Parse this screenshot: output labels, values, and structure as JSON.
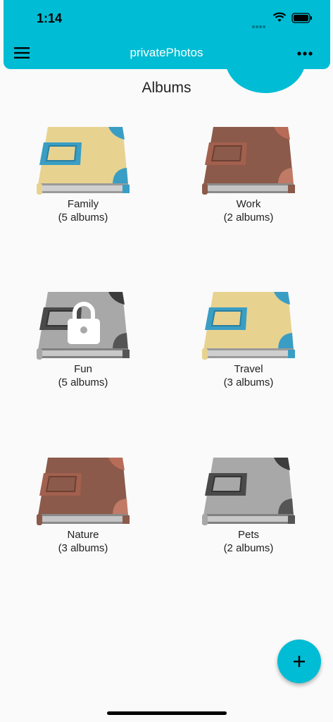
{
  "status_bar": {
    "time": "1:14"
  },
  "app_bar": {
    "title": "privatePhotos",
    "menu_icon": "hamburger-icon",
    "more_icon": "more-horizontal-icon"
  },
  "page": {
    "heading": "Albums"
  },
  "albums": [
    {
      "name": "Family",
      "count": "(5 albums)",
      "theme": "yellow-blue",
      "locked": false
    },
    {
      "name": "Work",
      "count": "(2 albums)",
      "theme": "brown",
      "locked": false
    },
    {
      "name": "Fun",
      "count": "(5 albums)",
      "theme": "grey",
      "locked": true
    },
    {
      "name": "Travel",
      "count": "(3 albums)",
      "theme": "yellow-blue",
      "locked": false
    },
    {
      "name": "Nature",
      "count": "(3 albums)",
      "theme": "brown",
      "locked": false
    },
    {
      "name": "Pets",
      "count": "(2 albums)",
      "theme": "grey",
      "locked": false
    }
  ],
  "fab": {
    "icon": "plus-icon"
  },
  "colors": {
    "accent": "#00bcd4",
    "background": "#fafafa",
    "yellow_cover": "#e8d28f",
    "blue_accent": "#3a9ec4",
    "brown_cover": "#8b5a4a",
    "grey_cover": "#a8a8a8"
  }
}
